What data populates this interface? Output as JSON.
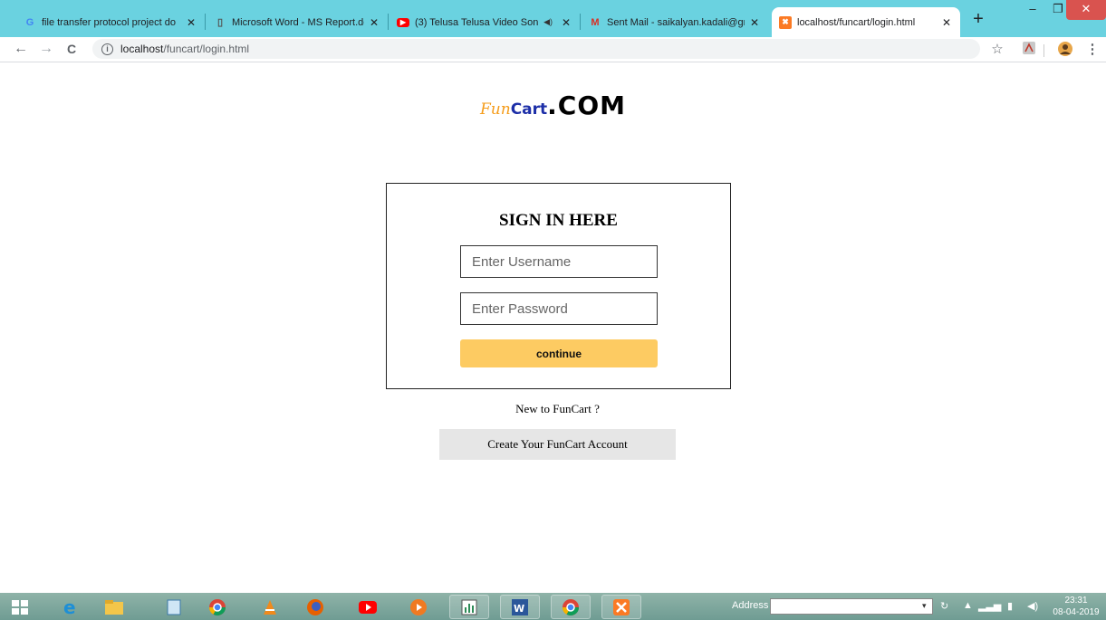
{
  "browser": {
    "tabs": [
      {
        "title": "file transfer protocol project do",
        "icon": "google-icon",
        "icon_glyph": "G",
        "icon_color": "#4285f4"
      },
      {
        "title": "Microsoft Word - MS Report.do",
        "icon": "document-icon",
        "icon_glyph": "▯",
        "icon_color": "#555555"
      },
      {
        "title": "(3) Telusa Telusa Video Son",
        "icon": "youtube-icon",
        "icon_glyph": "▶",
        "icon_color": "#ff0000",
        "audio": "◀)"
      },
      {
        "title": "Sent Mail - saikalyan.kadali@gr",
        "icon": "gmail-icon",
        "icon_glyph": "M",
        "icon_color": "#d93025"
      },
      {
        "title": "localhost/funcart/login.html",
        "icon": "xampp-icon",
        "icon_glyph": "✖",
        "icon_color": "#fb7a24"
      }
    ],
    "close_glyph": "✕",
    "new_tab_glyph": "+",
    "window": {
      "minimize": "‒",
      "restore": "❐",
      "close": "✕"
    },
    "url_host": "localhost",
    "url_path": "/funcart/login.html",
    "nav": {
      "back": "←",
      "forward": "→",
      "reload": "C",
      "info": "i"
    },
    "star": "☆",
    "menu": "⋮"
  },
  "logo": {
    "fun": "Fun",
    "cart": "Cart",
    "com": ".COM"
  },
  "login": {
    "heading": "SIGN IN HERE",
    "username_placeholder": "Enter Username",
    "password_placeholder": "Enter Password",
    "continue_label": "continue"
  },
  "signup": {
    "prompt": "New to FunCart ?",
    "button_label": "Create Your FunCart Account"
  },
  "taskbar": {
    "address_label": "Address",
    "clock_time": "23:31",
    "clock_date": "08-04-2019"
  }
}
